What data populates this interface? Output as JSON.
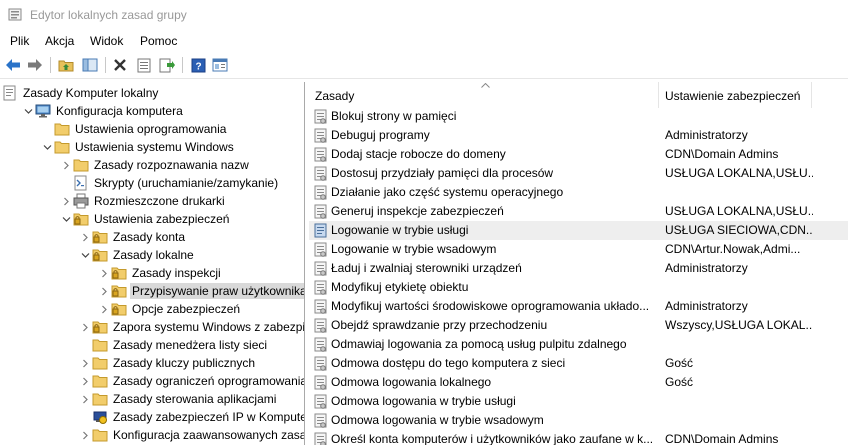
{
  "window": {
    "title": "Edytor lokalnych zasad grupy"
  },
  "menu": [
    "Plik",
    "Akcja",
    "Widok",
    "Pomoc"
  ],
  "toolbar": [
    "back-icon",
    "forward-icon",
    "up-folder-icon",
    "show-hide-tree-icon",
    "delete-icon",
    "properties-icon",
    "export-list-icon",
    "help-icon",
    "extended-view-icon"
  ],
  "tree": [
    {
      "label": "Zasady Komputer lokalny",
      "level": 0,
      "expander": "",
      "icon": "computer-policy"
    },
    {
      "label": "Konfiguracja komputera",
      "level": 1,
      "expander": "open",
      "icon": "computer"
    },
    {
      "label": "Ustawienia oprogramowania",
      "level": 2,
      "expander": "",
      "icon": "folder"
    },
    {
      "label": "Ustawienia systemu Windows",
      "level": 2,
      "expander": "open",
      "icon": "folder"
    },
    {
      "label": "Zasady rozpoznawania nazw",
      "level": 3,
      "expander": "closed",
      "icon": "folder"
    },
    {
      "label": "Skrypty (uruchamianie/zamykanie)",
      "level": 3,
      "expander": "",
      "icon": "script"
    },
    {
      "label": "Rozmieszczone drukarki",
      "level": 3,
      "expander": "closed",
      "icon": "printer"
    },
    {
      "label": "Ustawienia zabezpieczeń",
      "level": 3,
      "expander": "open",
      "icon": "security-folder"
    },
    {
      "label": "Zasady konta",
      "level": 4,
      "expander": "closed",
      "icon": "security-folder"
    },
    {
      "label": "Zasady lokalne",
      "level": 4,
      "expander": "open",
      "icon": "security-folder"
    },
    {
      "label": "Zasady inspekcji",
      "level": 5,
      "expander": "closed",
      "icon": "security-folder"
    },
    {
      "label": "Przypisywanie praw użytkownika",
      "level": 5,
      "expander": "closed",
      "icon": "security-folder",
      "selected": true
    },
    {
      "label": "Opcje zabezpieczeń",
      "level": 5,
      "expander": "closed",
      "icon": "security-folder"
    },
    {
      "label": "Zapora systemu Windows z zabezpiecz",
      "level": 4,
      "expander": "closed",
      "icon": "security-folder"
    },
    {
      "label": "Zasady menedżera listy sieci",
      "level": 4,
      "expander": "",
      "icon": "folder"
    },
    {
      "label": "Zasady kluczy publicznych",
      "level": 4,
      "expander": "closed",
      "icon": "folder"
    },
    {
      "label": "Zasady ograniczeń oprogramowania",
      "level": 4,
      "expander": "closed",
      "icon": "folder"
    },
    {
      "label": "Zasady sterowania aplikacjami",
      "level": 4,
      "expander": "closed",
      "icon": "folder"
    },
    {
      "label": "Zasady zabezpieczeń IP w Komputer lo",
      "level": 4,
      "expander": "",
      "icon": "ip-security"
    },
    {
      "label": "Konfiguracja zaawansowanych zasad in",
      "level": 4,
      "expander": "closed",
      "icon": "folder"
    }
  ],
  "list": {
    "columns": [
      "Zasady",
      "Ustawienie zabezpieczeń"
    ],
    "rows": [
      {
        "name": "Blokuj strony w pamięci",
        "value": ""
      },
      {
        "name": "Debuguj programy",
        "value": "Administratorzy"
      },
      {
        "name": "Dodaj stacje robocze do domeny",
        "value": "CDN\\Domain Admins"
      },
      {
        "name": "Dostosuj przydziały pamięci dla procesów",
        "value": "USŁUGA LOKALNA,USŁU..."
      },
      {
        "name": "Działanie jako część systemu operacyjnego",
        "value": ""
      },
      {
        "name": "Generuj inspekcje zabezpieczeń",
        "value": "USŁUGA LOKALNA,USŁU..."
      },
      {
        "name": "Logowanie w trybie usługi",
        "value": "USŁUGA SIECIOWA,CDN...",
        "highlight": true
      },
      {
        "name": "Logowanie w trybie wsadowym",
        "value": "CDN\\Artur.Nowak,Admi..."
      },
      {
        "name": "Ładuj i zwalniaj sterowniki urządzeń",
        "value": "Administratorzy"
      },
      {
        "name": "Modyfikuj etykietę obiektu",
        "value": ""
      },
      {
        "name": "Modyfikuj wartości środowiskowe oprogramowania układo...",
        "value": "Administratorzy"
      },
      {
        "name": "Obejdź sprawdzanie przy przechodzeniu",
        "value": "Wszyscy,USŁUGA LOKAL..."
      },
      {
        "name": "Odmawiaj logowania za pomocą usług pulpitu zdalnego",
        "value": ""
      },
      {
        "name": "Odmowa dostępu do tego komputera z sieci",
        "value": "Gość"
      },
      {
        "name": "Odmowa logowania lokalnego",
        "value": "Gość"
      },
      {
        "name": "Odmowa logowania w trybie usługi",
        "value": ""
      },
      {
        "name": "Odmowa logowania w trybie wsadowym",
        "value": ""
      },
      {
        "name": "Określ konta komputerów i użytkowników jako zaufane w k...",
        "value": "CDN\\Domain Admins"
      }
    ]
  }
}
